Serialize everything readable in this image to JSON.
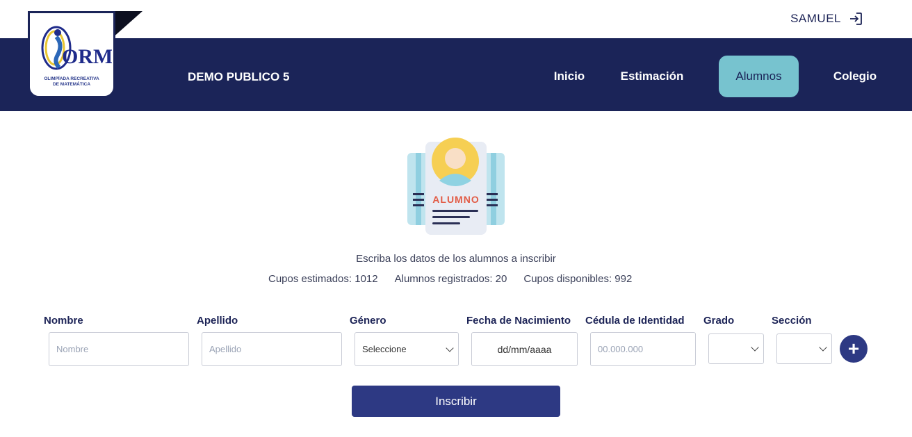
{
  "user": {
    "name": "SAMUEL",
    "logout_icon": "logout-icon"
  },
  "logo": {
    "text": "ORM",
    "subtitle_line1": "OLIMPÍADA RECREATIVA",
    "subtitle_line2": "DE MATEMÁTICA"
  },
  "header": {
    "organization": "DEMO PUBLICO 5"
  },
  "nav": {
    "inicio": "Inicio",
    "estimacion": "Estimación",
    "alumnos": "Alumnos",
    "colegio": "Colegio",
    "active": "Alumnos"
  },
  "illustration": {
    "badge_text": "ALUMNO",
    "icon": "student-id-card-icon"
  },
  "intro": "Escriba los datos de los alumnos a inscribir",
  "stats": {
    "estimated": "Cupos estimados: 1012",
    "registered": "Alumnos registrados: 20",
    "available": "Cupos disponibles: 992"
  },
  "form": {
    "nombre_label": "Nombre",
    "nombre_placeholder": "Nombre",
    "apellido_label": "Apellido",
    "apellido_placeholder": "Apellido",
    "genero_label": "Género",
    "genero_value": "Seleccione",
    "fecha_label": "Fecha de Nacimiento",
    "fecha_value": "dd/mm/aaaa",
    "cedula_label": "Cédula de Identidad",
    "cedula_placeholder": "00.000.000",
    "grado_label": "Grado",
    "grado_value": "",
    "seccion_label": "Sección",
    "seccion_value": "",
    "add_symbol": "+"
  },
  "submit_label": "Inscribir",
  "colors": {
    "navy": "#1b2458",
    "accent": "#77c3cf",
    "button": "#2d3983"
  }
}
